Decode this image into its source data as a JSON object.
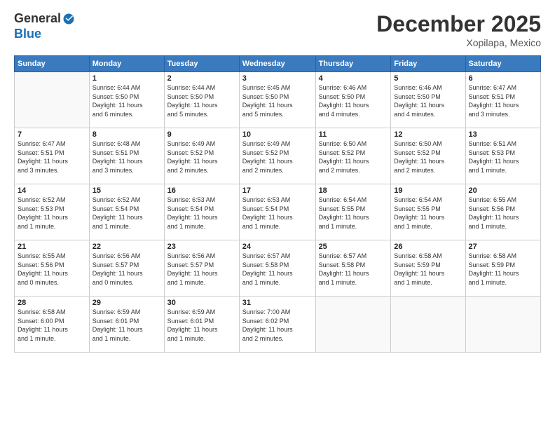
{
  "logo": {
    "general": "General",
    "blue": "Blue"
  },
  "title": "December 2025",
  "location": "Xopilapa, Mexico",
  "weekdays": [
    "Sunday",
    "Monday",
    "Tuesday",
    "Wednesday",
    "Thursday",
    "Friday",
    "Saturday"
  ],
  "weeks": [
    [
      {
        "day": "",
        "info": ""
      },
      {
        "day": "1",
        "info": "Sunrise: 6:44 AM\nSunset: 5:50 PM\nDaylight: 11 hours\nand 6 minutes."
      },
      {
        "day": "2",
        "info": "Sunrise: 6:44 AM\nSunset: 5:50 PM\nDaylight: 11 hours\nand 5 minutes."
      },
      {
        "day": "3",
        "info": "Sunrise: 6:45 AM\nSunset: 5:50 PM\nDaylight: 11 hours\nand 5 minutes."
      },
      {
        "day": "4",
        "info": "Sunrise: 6:46 AM\nSunset: 5:50 PM\nDaylight: 11 hours\nand 4 minutes."
      },
      {
        "day": "5",
        "info": "Sunrise: 6:46 AM\nSunset: 5:50 PM\nDaylight: 11 hours\nand 4 minutes."
      },
      {
        "day": "6",
        "info": "Sunrise: 6:47 AM\nSunset: 5:51 PM\nDaylight: 11 hours\nand 3 minutes."
      }
    ],
    [
      {
        "day": "7",
        "info": "Sunrise: 6:47 AM\nSunset: 5:51 PM\nDaylight: 11 hours\nand 3 minutes."
      },
      {
        "day": "8",
        "info": "Sunrise: 6:48 AM\nSunset: 5:51 PM\nDaylight: 11 hours\nand 3 minutes."
      },
      {
        "day": "9",
        "info": "Sunrise: 6:49 AM\nSunset: 5:52 PM\nDaylight: 11 hours\nand 2 minutes."
      },
      {
        "day": "10",
        "info": "Sunrise: 6:49 AM\nSunset: 5:52 PM\nDaylight: 11 hours\nand 2 minutes."
      },
      {
        "day": "11",
        "info": "Sunrise: 6:50 AM\nSunset: 5:52 PM\nDaylight: 11 hours\nand 2 minutes."
      },
      {
        "day": "12",
        "info": "Sunrise: 6:50 AM\nSunset: 5:52 PM\nDaylight: 11 hours\nand 2 minutes."
      },
      {
        "day": "13",
        "info": "Sunrise: 6:51 AM\nSunset: 5:53 PM\nDaylight: 11 hours\nand 1 minute."
      }
    ],
    [
      {
        "day": "14",
        "info": "Sunrise: 6:52 AM\nSunset: 5:53 PM\nDaylight: 11 hours\nand 1 minute."
      },
      {
        "day": "15",
        "info": "Sunrise: 6:52 AM\nSunset: 5:54 PM\nDaylight: 11 hours\nand 1 minute."
      },
      {
        "day": "16",
        "info": "Sunrise: 6:53 AM\nSunset: 5:54 PM\nDaylight: 11 hours\nand 1 minute."
      },
      {
        "day": "17",
        "info": "Sunrise: 6:53 AM\nSunset: 5:54 PM\nDaylight: 11 hours\nand 1 minute."
      },
      {
        "day": "18",
        "info": "Sunrise: 6:54 AM\nSunset: 5:55 PM\nDaylight: 11 hours\nand 1 minute."
      },
      {
        "day": "19",
        "info": "Sunrise: 6:54 AM\nSunset: 5:55 PM\nDaylight: 11 hours\nand 1 minute."
      },
      {
        "day": "20",
        "info": "Sunrise: 6:55 AM\nSunset: 5:56 PM\nDaylight: 11 hours\nand 1 minute."
      }
    ],
    [
      {
        "day": "21",
        "info": "Sunrise: 6:55 AM\nSunset: 5:56 PM\nDaylight: 11 hours\nand 0 minutes."
      },
      {
        "day": "22",
        "info": "Sunrise: 6:56 AM\nSunset: 5:57 PM\nDaylight: 11 hours\nand 0 minutes."
      },
      {
        "day": "23",
        "info": "Sunrise: 6:56 AM\nSunset: 5:57 PM\nDaylight: 11 hours\nand 1 minute."
      },
      {
        "day": "24",
        "info": "Sunrise: 6:57 AM\nSunset: 5:58 PM\nDaylight: 11 hours\nand 1 minute."
      },
      {
        "day": "25",
        "info": "Sunrise: 6:57 AM\nSunset: 5:58 PM\nDaylight: 11 hours\nand 1 minute."
      },
      {
        "day": "26",
        "info": "Sunrise: 6:58 AM\nSunset: 5:59 PM\nDaylight: 11 hours\nand 1 minute."
      },
      {
        "day": "27",
        "info": "Sunrise: 6:58 AM\nSunset: 5:59 PM\nDaylight: 11 hours\nand 1 minute."
      }
    ],
    [
      {
        "day": "28",
        "info": "Sunrise: 6:58 AM\nSunset: 6:00 PM\nDaylight: 11 hours\nand 1 minute."
      },
      {
        "day": "29",
        "info": "Sunrise: 6:59 AM\nSunset: 6:01 PM\nDaylight: 11 hours\nand 1 minute."
      },
      {
        "day": "30",
        "info": "Sunrise: 6:59 AM\nSunset: 6:01 PM\nDaylight: 11 hours\nand 1 minute."
      },
      {
        "day": "31",
        "info": "Sunrise: 7:00 AM\nSunset: 6:02 PM\nDaylight: 11 hours\nand 2 minutes."
      },
      {
        "day": "",
        "info": ""
      },
      {
        "day": "",
        "info": ""
      },
      {
        "day": "",
        "info": ""
      }
    ]
  ]
}
